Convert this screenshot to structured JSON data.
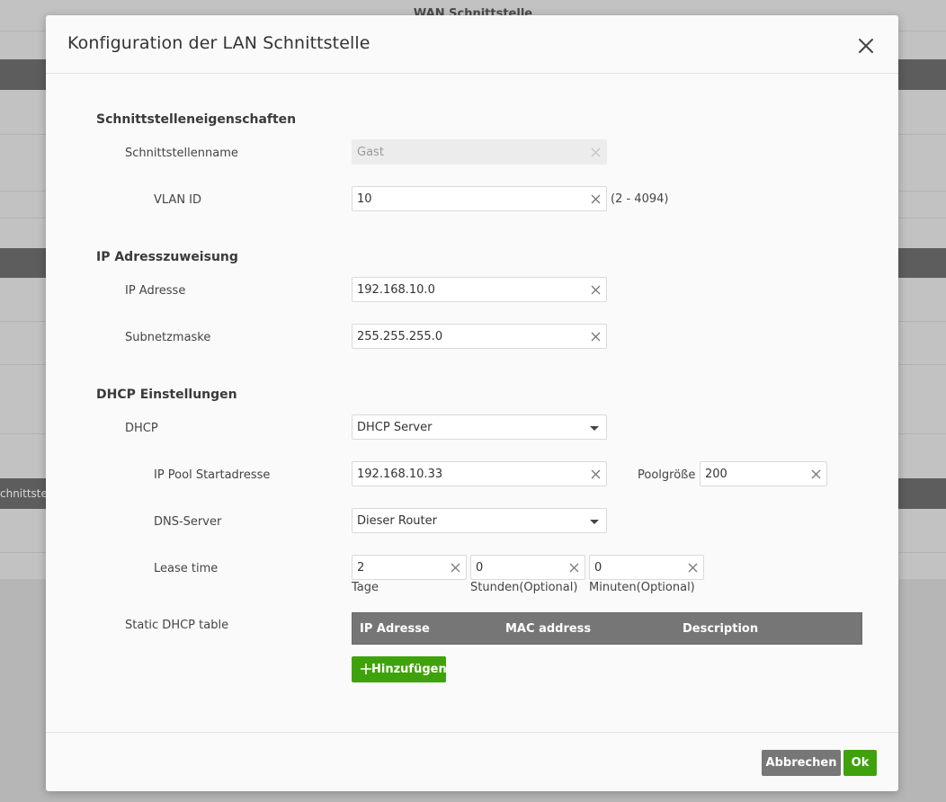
{
  "background": {
    "title": "WAN Schnittstelle",
    "side_text": "chnittste"
  },
  "dialog": {
    "title": "Konfiguration der LAN Schnittstelle",
    "close_icon": "close-icon"
  },
  "sections": {
    "interface": {
      "title": "Schnittstelleneigenschaften",
      "name_label": "Schnittstellenname",
      "name_value": "Gast",
      "vlan_label": "VLAN ID",
      "vlan_value": "10",
      "vlan_hint": "(2 - 4094)"
    },
    "ip": {
      "title": "IP Adresszuweisung",
      "address_label": "IP Adresse",
      "address_value": "192.168.10.0",
      "mask_label": "Subnetzmaske",
      "mask_value": "255.255.255.0"
    },
    "dhcp": {
      "title": "DHCP Einstellungen",
      "mode_label": "DHCP",
      "mode_value": "DHCP Server",
      "pool_start_label": "IP Pool Startadresse",
      "pool_start_value": "192.168.10.33",
      "pool_size_label": "Poolgröße",
      "pool_size_value": "200",
      "dns_label": "DNS-Server",
      "dns_value": "Dieser Router",
      "lease_label": "Lease time",
      "lease_days_value": "2",
      "lease_days_caption": "Tage",
      "lease_hours_value": "0",
      "lease_hours_caption": "Stunden(Optional)",
      "lease_minutes_value": "0",
      "lease_minutes_caption": "Minuten(Optional)",
      "static_table_label": "Static DHCP table",
      "table_columns": [
        "IP Adresse",
        "MAC address",
        "Description"
      ],
      "add_button": "Hinzufügen"
    }
  },
  "footer": {
    "cancel_button": "Abbrechen",
    "ok_button": "Ok"
  },
  "colors": {
    "accent_green": "#3fa20d",
    "table_header": "#767676",
    "cancel_gray": "#777777"
  }
}
